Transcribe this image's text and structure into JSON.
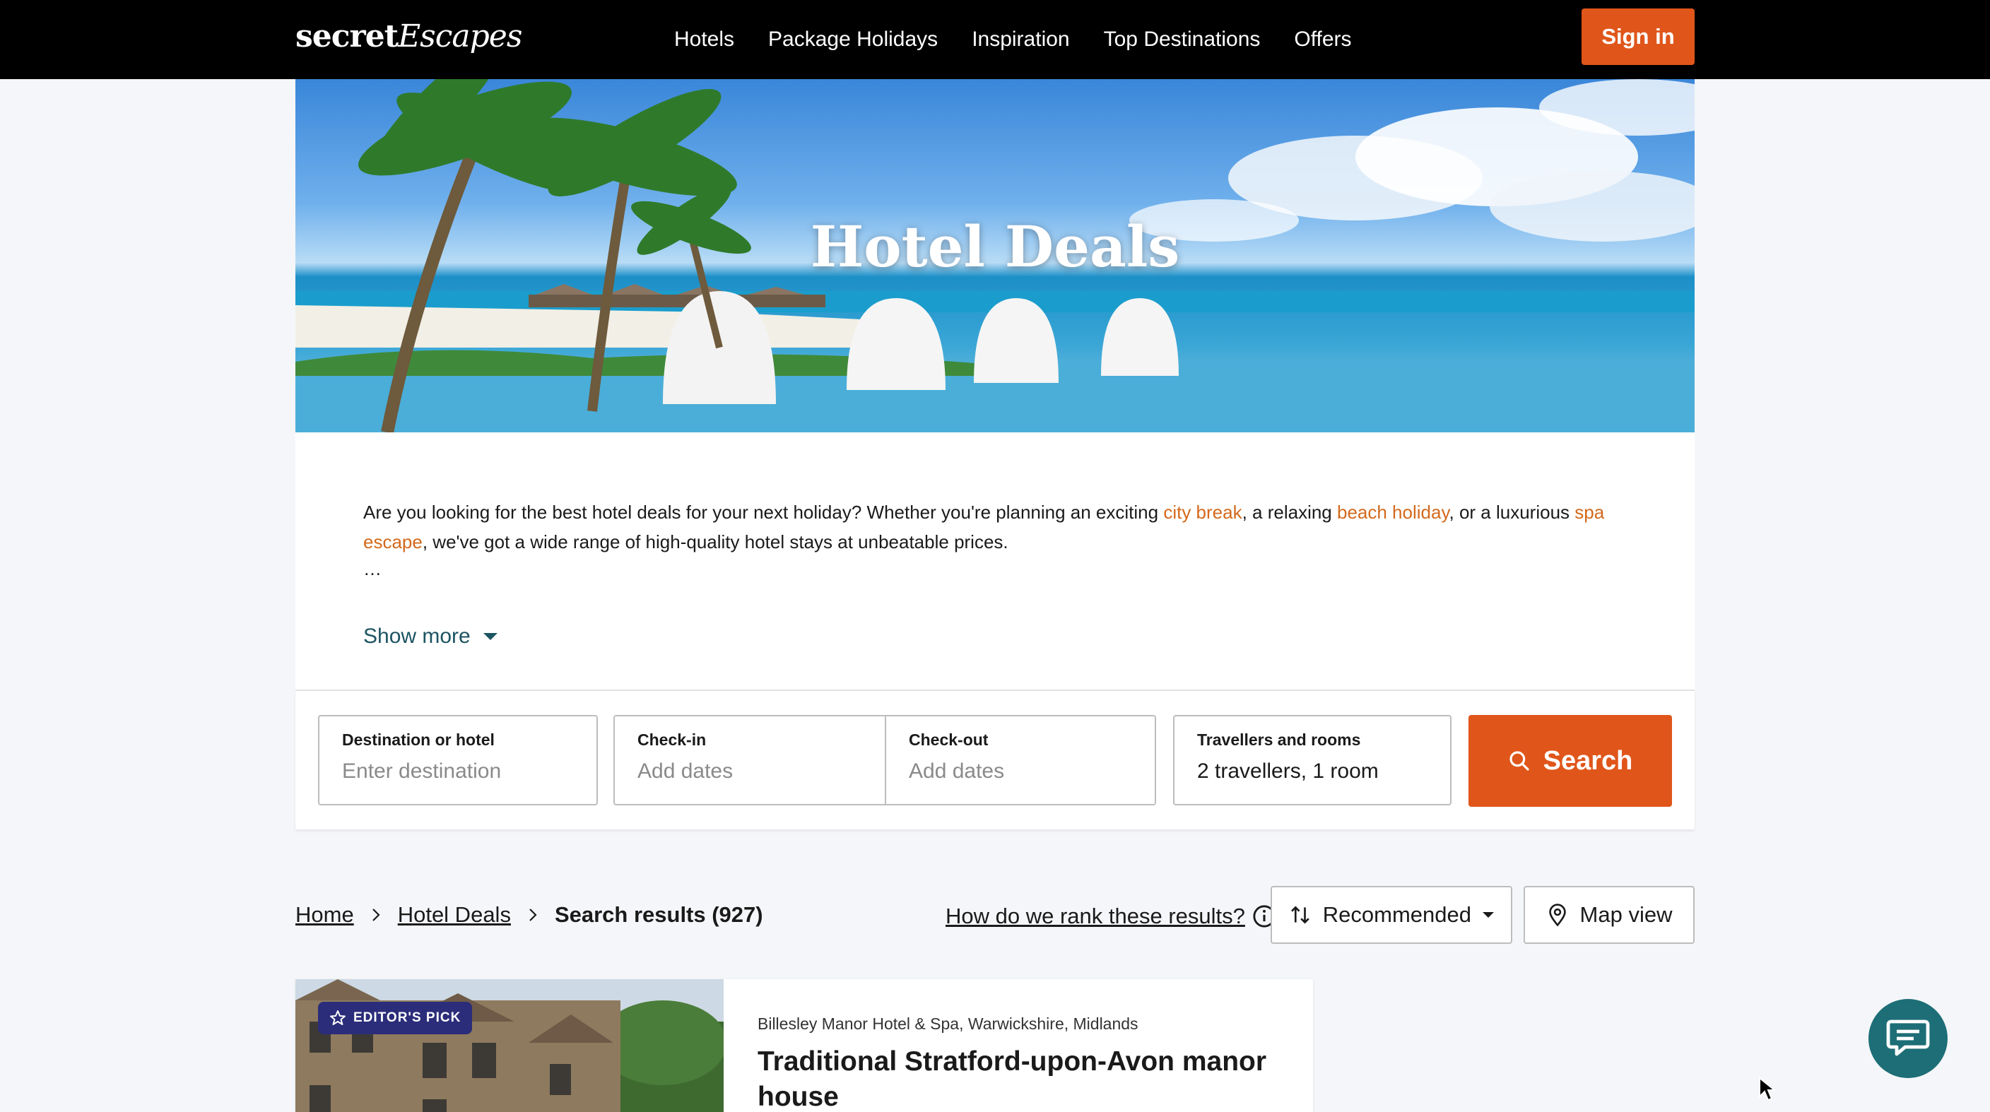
{
  "header": {
    "logo_part1": "secret",
    "logo_part2": "Escapes",
    "nav": [
      "Hotels",
      "Package Holidays",
      "Inspiration",
      "Top Destinations",
      "Offers"
    ],
    "signin_label": "Sign in"
  },
  "hero": {
    "title": "Hotel Deals"
  },
  "intro": {
    "t1": "Are you looking for the best hotel deals for your next holiday? Whether you're planning an exciting ",
    "link1": "city break",
    "t2": ", a relaxing ",
    "link2": "beach holiday",
    "t3": ", or a luxurious ",
    "link3": "spa escape",
    "t4": ", we've got a wide range of high-quality hotel stays at unbeatable prices.",
    "ellipsis": "…",
    "show_more": "Show more"
  },
  "search": {
    "destination_label": "Destination or hotel",
    "destination_placeholder": "Enter destination",
    "checkin_label": "Check-in",
    "checkin_placeholder": "Add dates",
    "checkout_label": "Check-out",
    "checkout_placeholder": "Add dates",
    "travellers_label": "Travellers and rooms",
    "travellers_value": "2 travellers, 1 room",
    "search_label": "Search"
  },
  "results": {
    "breadcrumb": [
      "Home",
      "Hotel Deals"
    ],
    "current": "Search results (927)",
    "rank_link": "How do we rank these results?",
    "sort_value": "Recommended",
    "map_label": "Map view"
  },
  "card": {
    "badge": "EDITOR'S PICK",
    "location": "Billesley Manor Hotel & Spa, Warwickshire, Midlands",
    "title": "Traditional Stratford-upon-Avon manor house"
  },
  "colors": {
    "brand_orange": "#e0561a",
    "link_orange": "#d4691c",
    "teal": "#1d6e76",
    "badge_navy": "#2b2d7a"
  }
}
